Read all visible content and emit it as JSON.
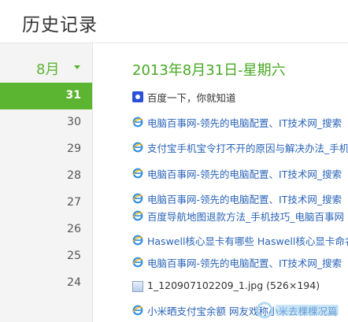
{
  "page": {
    "title": "历史记录"
  },
  "sidebar": {
    "month": "8月",
    "days": [
      "31",
      "30",
      "29",
      "28",
      "27",
      "26",
      "25",
      "24"
    ],
    "active_day": "31"
  },
  "main": {
    "date_heading": "2013年8月31日-星期六",
    "entries": [
      {
        "text": "百度一下，你就知道",
        "icon": "baidu-paw-icon"
      },
      {
        "text": "电脑百事网-领先的电脑配置、IT技术网_搜索",
        "icon": "ie-icon"
      },
      {
        "text": "支付宝手机宝令打不开的原因与解决办法_手机",
        "icon": "ie-icon"
      },
      {
        "text": "电脑百事网-领先的电脑配置、IT技术网_搜索",
        "icon": "ie-icon"
      },
      {
        "text": "电脑百事网-领先的电脑配置、IT技术网_搜索",
        "icon": "ie-icon"
      },
      {
        "text": "百度导航地图退款方法_手机技巧_电脑百事网",
        "icon": "ie-icon"
      },
      {
        "text": "Haswell核心显卡有哪些 Haswell核心显卡命名",
        "icon": "ie-icon"
      },
      {
        "text": "电脑百事网-领先的电脑配置、IT技术网_搜索",
        "icon": "ie-icon"
      },
      {
        "text": "1_120907102209_1.jpg (526×194)",
        "icon": "image-file-icon"
      },
      {
        "text": "小米晒支付宝余额 网友戏称小米去棵棵况篇",
        "icon": "ie-icon"
      }
    ]
  },
  "colors": {
    "accent_green": "#5cb531",
    "heading_green": "#47a923",
    "link_blue": "#2a64b8",
    "sidebar_bg": "#f4f4f4"
  }
}
